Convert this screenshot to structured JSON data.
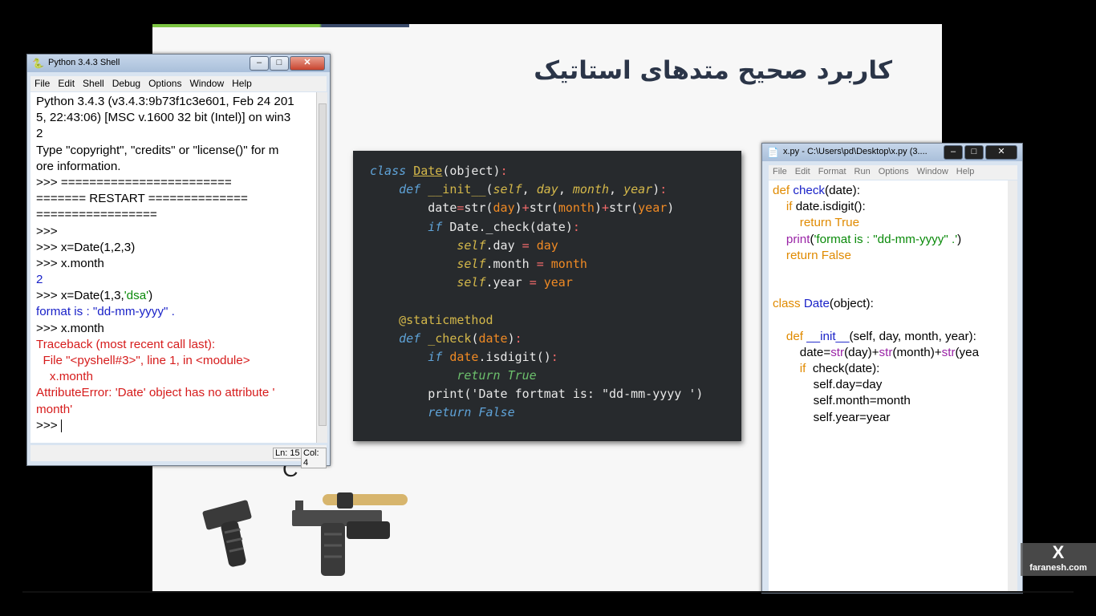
{
  "slide": {
    "title": "کاربرد صحیح متدهای استاتیک"
  },
  "code_box": {
    "lines": [
      [
        {
          "c": "kw",
          "t": "class "
        },
        {
          "c": "cls",
          "t": "Date"
        },
        {
          "c": "pl",
          "t": "(object)"
        },
        {
          "c": "op",
          "t": ":"
        }
      ],
      [
        {
          "c": "pl",
          "t": "    "
        },
        {
          "c": "kw",
          "t": "def "
        },
        {
          "c": "fn",
          "t": "__init__"
        },
        {
          "c": "pl",
          "t": "("
        },
        {
          "c": "sf",
          "t": "self"
        },
        {
          "c": "pl",
          "t": ", "
        },
        {
          "c": "sf",
          "t": "day"
        },
        {
          "c": "pl",
          "t": ", "
        },
        {
          "c": "sf",
          "t": "month"
        },
        {
          "c": "pl",
          "t": ", "
        },
        {
          "c": "sf",
          "t": "year"
        },
        {
          "c": "pl",
          "t": ")"
        },
        {
          "c": "op",
          "t": ":"
        }
      ],
      [
        {
          "c": "pl",
          "t": "        date"
        },
        {
          "c": "op",
          "t": "="
        },
        {
          "c": "pl",
          "t": "str("
        },
        {
          "c": "ar",
          "t": "day"
        },
        {
          "c": "pl",
          "t": ")"
        },
        {
          "c": "op",
          "t": "+"
        },
        {
          "c": "pl",
          "t": "str("
        },
        {
          "c": "ar",
          "t": "month"
        },
        {
          "c": "pl",
          "t": ")"
        },
        {
          "c": "op",
          "t": "+"
        },
        {
          "c": "pl",
          "t": "str("
        },
        {
          "c": "ar",
          "t": "year"
        },
        {
          "c": "pl",
          "t": ")"
        }
      ],
      [
        {
          "c": "pl",
          "t": "        "
        },
        {
          "c": "kw",
          "t": "if "
        },
        {
          "c": "pl",
          "t": "Date._check(date)"
        },
        {
          "c": "op",
          "t": ":"
        }
      ],
      [
        {
          "c": "pl",
          "t": "            "
        },
        {
          "c": "sf",
          "t": "self"
        },
        {
          "c": "pl",
          "t": ".day "
        },
        {
          "c": "op",
          "t": "="
        },
        {
          "c": "ar",
          "t": " day"
        }
      ],
      [
        {
          "c": "pl",
          "t": "            "
        },
        {
          "c": "sf",
          "t": "self"
        },
        {
          "c": "pl",
          "t": ".month "
        },
        {
          "c": "op",
          "t": "="
        },
        {
          "c": "ar",
          "t": " month"
        }
      ],
      [
        {
          "c": "pl",
          "t": "            "
        },
        {
          "c": "sf",
          "t": "self"
        },
        {
          "c": "pl",
          "t": ".year "
        },
        {
          "c": "op",
          "t": "="
        },
        {
          "c": "ar",
          "t": " year"
        }
      ],
      [
        {
          "c": "pl",
          "t": ""
        }
      ],
      [
        {
          "c": "pl",
          "t": "    "
        },
        {
          "c": "dc",
          "t": "@staticmethod"
        }
      ],
      [
        {
          "c": "pl",
          "t": "    "
        },
        {
          "c": "kw",
          "t": "def "
        },
        {
          "c": "fn",
          "t": "_check"
        },
        {
          "c": "pl",
          "t": "("
        },
        {
          "c": "ar",
          "t": "date"
        },
        {
          "c": "pl",
          "t": ")"
        },
        {
          "c": "op",
          "t": ":"
        }
      ],
      [
        {
          "c": "pl",
          "t": "        "
        },
        {
          "c": "kw",
          "t": "if "
        },
        {
          "c": "ar",
          "t": "date"
        },
        {
          "c": "pl",
          "t": ".isdigit()"
        },
        {
          "c": "op",
          "t": ":"
        }
      ],
      [
        {
          "c": "pl",
          "t": "            "
        },
        {
          "c": "tr",
          "t": "return True"
        }
      ],
      [
        {
          "c": "pl",
          "t": "        print('Date fortmat is: \"dd-mm-yyyy ')"
        }
      ],
      [
        {
          "c": "pl",
          "t": "        "
        },
        {
          "c": "kw",
          "t": "return False"
        }
      ]
    ]
  },
  "shell": {
    "title": "Python 3.4.3 Shell",
    "menu": [
      "File",
      "Edit",
      "Shell",
      "Debug",
      "Options",
      "Window",
      "Help"
    ],
    "lines": [
      [
        {
          "c": "",
          "t": "Python 3.4.3 (v3.4.3:9b73f1c3e601, Feb 24 201"
        }
      ],
      [
        {
          "c": "",
          "t": "5, 22:43:06) [MSC v.1600 32 bit (Intel)] on win3"
        }
      ],
      [
        {
          "c": "",
          "t": "2"
        }
      ],
      [
        {
          "c": "",
          "t": "Type \"copyright\", \"credits\" or \"license()\" for m"
        }
      ],
      [
        {
          "c": "",
          "t": "ore information."
        }
      ],
      [
        {
          "c": "",
          "t": ">>> ========================"
        }
      ],
      [
        {
          "c": "",
          "t": "======= RESTART =============="
        }
      ],
      [
        {
          "c": "",
          "t": "================="
        }
      ],
      [
        {
          "c": "",
          "t": ">>> "
        }
      ],
      [
        {
          "c": "",
          "t": ">>> x=Date(1,2,3)"
        }
      ],
      [
        {
          "c": "",
          "t": ">>> x.month"
        }
      ],
      [
        {
          "c": "blue",
          "t": "2"
        }
      ],
      [
        {
          "c": "",
          "t": ">>> x=Date(1,3,"
        },
        {
          "c": "green",
          "t": "'dsa'"
        },
        {
          "c": "",
          "t": ")"
        }
      ],
      [
        {
          "c": "blue",
          "t": "format is : \"dd-mm-yyyy\" ."
        }
      ],
      [
        {
          "c": "",
          "t": ">>> x.month"
        }
      ],
      [
        {
          "c": "red",
          "t": "Traceback (most recent call last):"
        }
      ],
      [
        {
          "c": "red",
          "t": "  File \"<pyshell#3>\", line 1, in <module>"
        }
      ],
      [
        {
          "c": "red",
          "t": "    x.month"
        }
      ],
      [
        {
          "c": "red",
          "t": "AttributeError: 'Date' object has no attribute '"
        }
      ],
      [
        {
          "c": "red",
          "t": "month'"
        }
      ],
      [
        {
          "c": "",
          "t": ">>> "
        }
      ]
    ],
    "status_ln": "Ln: 15",
    "status_col": "Col: 4"
  },
  "editor": {
    "title": "x.py - C:\\Users\\pd\\Desktop\\x.py (3....",
    "menu": [
      "File",
      "Edit",
      "Format",
      "Run",
      "Options",
      "Window",
      "Help"
    ],
    "lines": [
      [
        {
          "c": "orange",
          "t": "def "
        },
        {
          "c": "blue",
          "t": "check"
        },
        {
          "c": "",
          "t": "(date):"
        }
      ],
      [
        {
          "c": "",
          "t": "    "
        },
        {
          "c": "orange",
          "t": "if "
        },
        {
          "c": "",
          "t": "date.isdigit():"
        }
      ],
      [
        {
          "c": "",
          "t": "        "
        },
        {
          "c": "orange",
          "t": "return True"
        }
      ],
      [
        {
          "c": "",
          "t": "    "
        },
        {
          "c": "purple",
          "t": "print"
        },
        {
          "c": "",
          "t": "("
        },
        {
          "c": "green",
          "t": "'format is : \"dd-mm-yyyy\" .'"
        },
        {
          "c": "",
          "t": ")"
        }
      ],
      [
        {
          "c": "",
          "t": "    "
        },
        {
          "c": "orange",
          "t": "return False"
        }
      ],
      [
        {
          "c": "",
          "t": ""
        }
      ],
      [
        {
          "c": "",
          "t": ""
        }
      ],
      [
        {
          "c": "orange",
          "t": "class "
        },
        {
          "c": "blue",
          "t": "Date"
        },
        {
          "c": "",
          "t": "(object):"
        }
      ],
      [
        {
          "c": "",
          "t": ""
        }
      ],
      [
        {
          "c": "",
          "t": "    "
        },
        {
          "c": "orange",
          "t": "def "
        },
        {
          "c": "blue",
          "t": "__init__"
        },
        {
          "c": "",
          "t": "(self, day, month, year):"
        }
      ],
      [
        {
          "c": "",
          "t": "        date="
        },
        {
          "c": "purple",
          "t": "str"
        },
        {
          "c": "",
          "t": "(day)+"
        },
        {
          "c": "purple",
          "t": "str"
        },
        {
          "c": "",
          "t": "(month)+"
        },
        {
          "c": "purple",
          "t": "str"
        },
        {
          "c": "",
          "t": "(yea"
        }
      ],
      [
        {
          "c": "",
          "t": "        "
        },
        {
          "c": "orange",
          "t": "if "
        },
        {
          "c": "",
          "t": " check(date):"
        }
      ],
      [
        {
          "c": "",
          "t": "            self.day=day"
        }
      ],
      [
        {
          "c": "",
          "t": "            self.month=month"
        }
      ],
      [
        {
          "c": "",
          "t": "            self.year=year"
        }
      ]
    ]
  },
  "letter_c": "C",
  "watermark": {
    "site": "faranesh.com",
    "logo": "X"
  }
}
